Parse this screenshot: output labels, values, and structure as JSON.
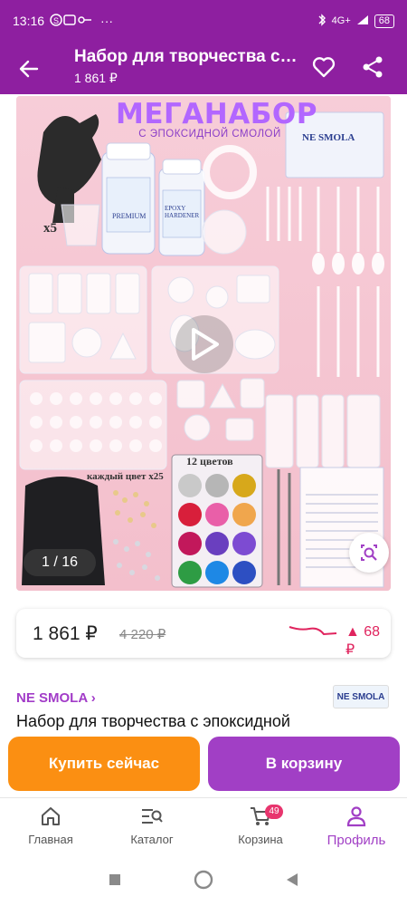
{
  "status_bar": {
    "time": "13:16",
    "network": "4G+",
    "battery": "68"
  },
  "header": {
    "title": "Набор для творчества с эпоксидной смолой",
    "price": "1 861 ₽"
  },
  "gallery": {
    "headline": "МЕГАНАБОР",
    "headline_sub": "С ЭПОКСИДНОЙ СМОЛОЙ",
    "counter": "1 / 16",
    "brand_box": "NE SMOLA",
    "x5": "x5",
    "colors_12": "12 цветов",
    "each_color": "каждый цвет x25",
    "bottle_a": "PREMIUM",
    "bottle_b": "EPOXY HARDENER"
  },
  "price_card": {
    "price": "1 861 ₽",
    "old_price": "4 220 ₽",
    "delta": "▲ 68 ₽"
  },
  "product": {
    "brand": "NE SMOLA ›",
    "brand_logo": "NE SMOLA",
    "title": "Набор для творчества с эпоксидной"
  },
  "actions": {
    "buy_now": "Купить сейчас",
    "to_cart": "В корзину"
  },
  "nav": {
    "home": "Главная",
    "catalog": "Каталог",
    "cart": "Корзина",
    "cart_count": "49",
    "profile": "Профиль"
  },
  "colors": {
    "accent": "#8e1fa0",
    "orange": "#fb8f12",
    "purple_button": "#a13fc5",
    "trend_red": "#e0245e"
  }
}
